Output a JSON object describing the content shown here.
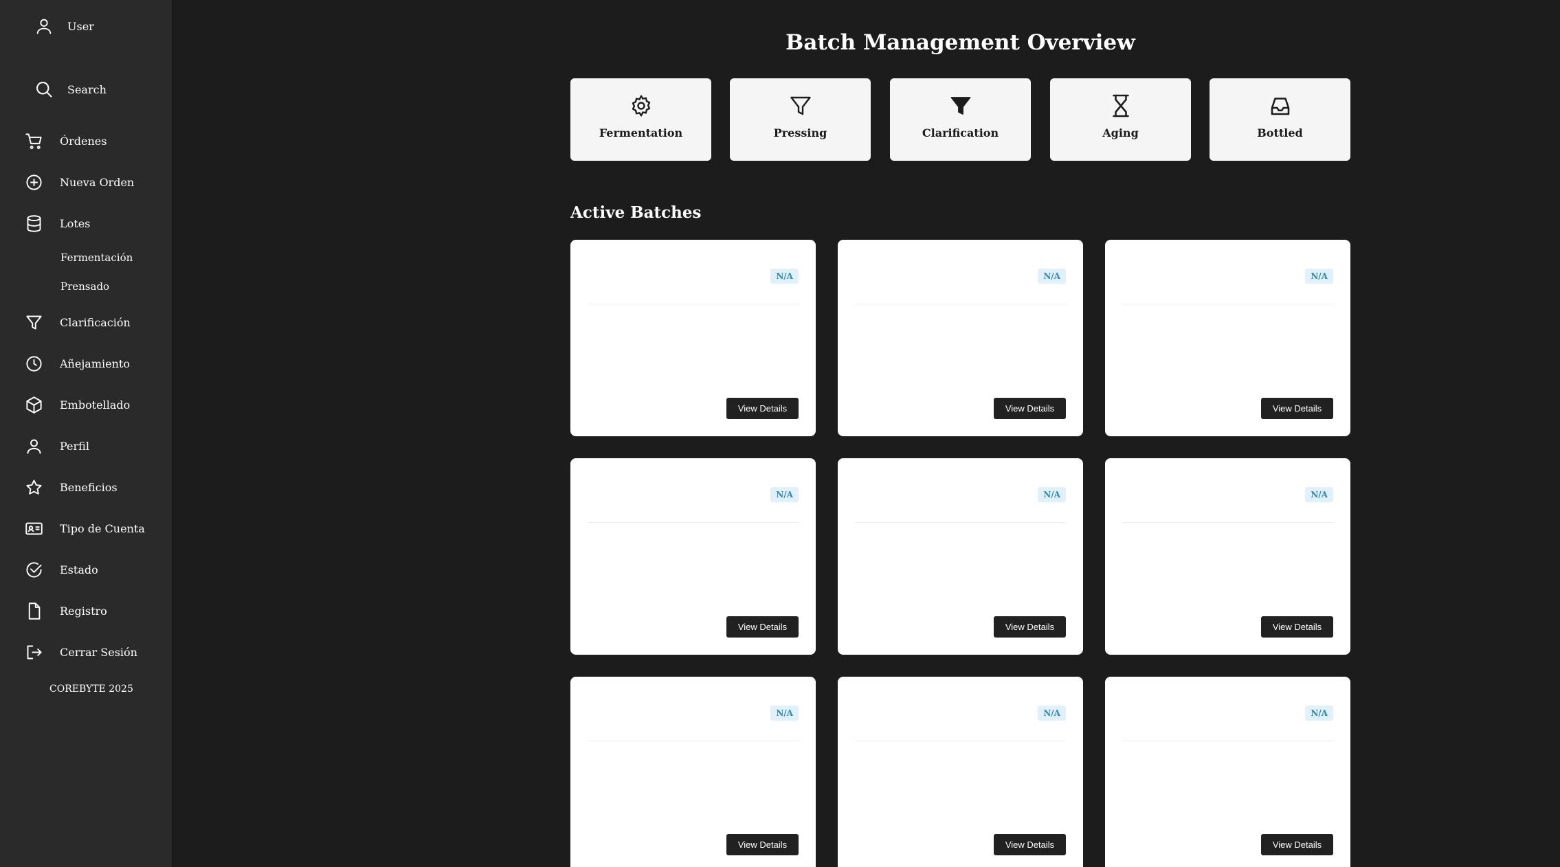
{
  "sidebar": {
    "user_label": "User",
    "search_label": "Search",
    "items": [
      {
        "label": "Órdenes",
        "icon": "cart-icon"
      },
      {
        "label": "Nueva Orden",
        "icon": "plus-circle-icon"
      },
      {
        "label": "Lotes",
        "icon": "database-icon"
      },
      {
        "label": "Clarificación",
        "icon": "filter-icon"
      },
      {
        "label": "Añejamiento",
        "icon": "clock-icon"
      },
      {
        "label": "Embotellado",
        "icon": "box-icon"
      },
      {
        "label": "Perfil",
        "icon": "user-icon"
      },
      {
        "label": "Beneficios",
        "icon": "star-icon"
      },
      {
        "label": "Tipo de Cuenta",
        "icon": "id-card-icon"
      },
      {
        "label": "Estado",
        "icon": "check-circle-icon"
      },
      {
        "label": "Registro",
        "icon": "file-icon"
      },
      {
        "label": "Cerrar Sesión",
        "icon": "logout-icon"
      }
    ],
    "subitems": [
      "Fermentación",
      "Prensado"
    ],
    "footer": "COREBYTE 2025"
  },
  "main": {
    "title": "Batch Management Overview",
    "stages": [
      {
        "label": "Fermentation",
        "icon": "gear-icon"
      },
      {
        "label": "Pressing",
        "icon": "filter-outline-icon"
      },
      {
        "label": "Clarification",
        "icon": "filter-filled-icon"
      },
      {
        "label": "Aging",
        "icon": "hourglass-icon"
      },
      {
        "label": "Bottled",
        "icon": "inbox-icon"
      }
    ],
    "section_title": "Active Batches",
    "batches": [
      {
        "status": "N/A",
        "button": "View Details"
      },
      {
        "status": "N/A",
        "button": "View Details"
      },
      {
        "status": "N/A",
        "button": "View Details"
      },
      {
        "status": "N/A",
        "button": "View Details"
      },
      {
        "status": "N/A",
        "button": "View Details"
      },
      {
        "status": "N/A",
        "button": "View Details"
      },
      {
        "status": "N/A",
        "button": "View Details"
      },
      {
        "status": "N/A",
        "button": "View Details"
      },
      {
        "status": "N/A",
        "button": "View Details"
      }
    ]
  },
  "colors": {
    "background": "#1c1c1c",
    "sidebar": "#2a2a2a",
    "card": "#ffffff",
    "stage_card": "#f5f5f5",
    "badge_bg": "#e1f1fb",
    "badge_text": "#2a8bc0",
    "button": "#212121"
  }
}
